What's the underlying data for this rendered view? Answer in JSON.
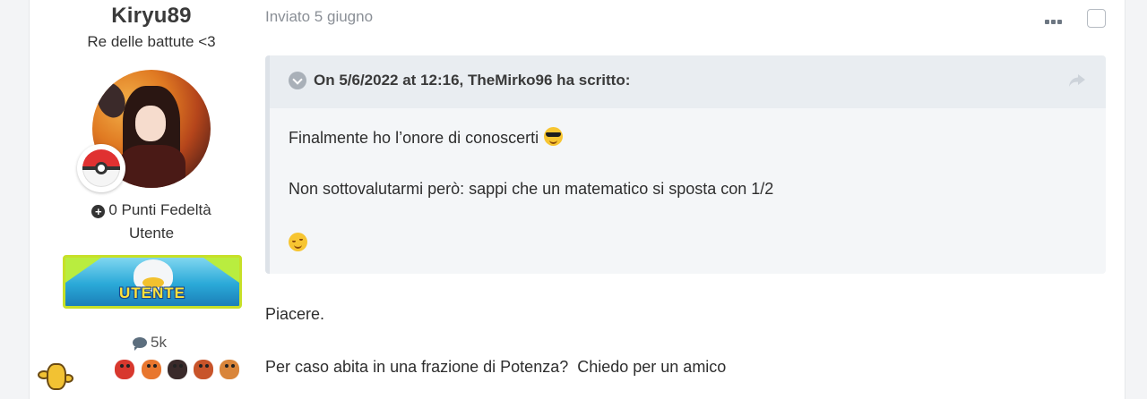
{
  "author": {
    "username": "Kiryu89",
    "title": "Re delle battute <3",
    "points": "0 Punti Fedeltà",
    "group": "Utente",
    "badge_label": "UTENTE",
    "post_count": "5k",
    "icons": [
      "plus-circle-icon",
      "comment-icon"
    ]
  },
  "post": {
    "meta": "Inviato 5 giugno",
    "quote": {
      "citation": "On 5/6/2022 at 12:16, TheMirko96 ha scritto:",
      "line1": "Finalmente ho l’onore di conoscerti",
      "line2": "Non sottovalutarmi però: sappi che un matematico si sposta con 1/2"
    },
    "body": {
      "line1": "Piacere.",
      "line2": "Per caso abita in una frazione di Potenza?  Chiedo per un amico"
    }
  },
  "colors": {
    "quote_bg": "#f4f6f8",
    "quote_head_bg": "#e9edf1",
    "quote_border": "#dde2e8",
    "meta_text": "#8a8f96",
    "badge_frame": "#c7e028"
  }
}
